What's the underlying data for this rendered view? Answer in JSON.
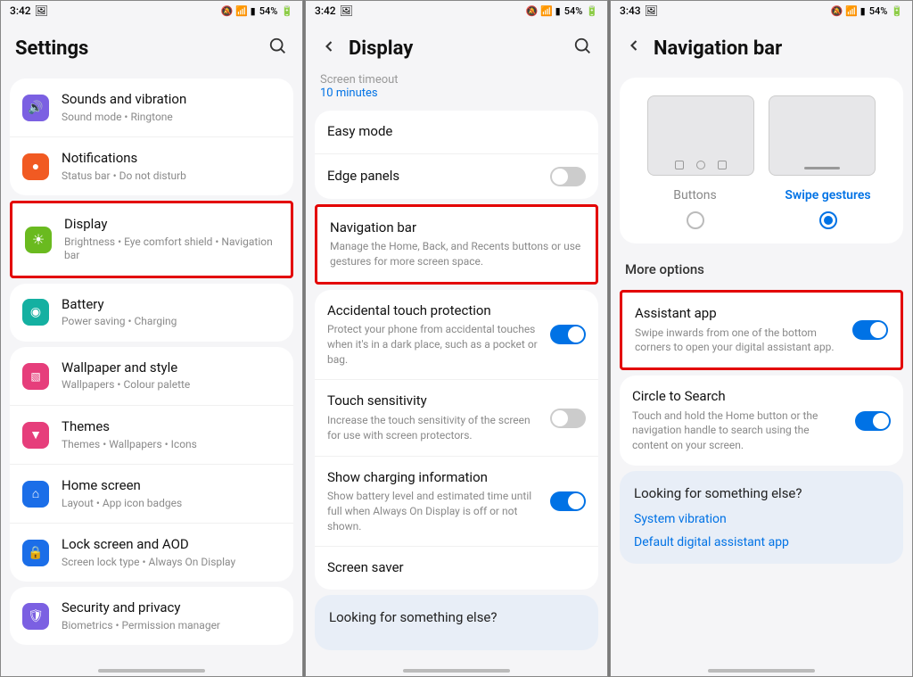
{
  "status": {
    "time_a": "3:42",
    "time_b": "3:42",
    "time_c": "3:43",
    "battery": "54%",
    "icons": "🔕 📶 📊"
  },
  "panel1": {
    "title": "Settings",
    "items": [
      {
        "title": "Sounds and vibration",
        "sub": "Sound mode  •  Ringtone",
        "color": "#7b60e2",
        "icon": "🔊"
      },
      {
        "title": "Notifications",
        "sub": "Status bar  •  Do not disturb",
        "color": "#f15a22",
        "icon": "🔔"
      },
      {
        "title": "Display",
        "sub": "Brightness  •  Eye comfort shield  •  Navigation bar",
        "color": "#6aba1f",
        "icon": "☀",
        "hl": true
      },
      {
        "title": "Battery",
        "sub": "Power saving  •  Charging",
        "color": "#14b0a1",
        "icon": "◎"
      },
      {
        "title": "Wallpaper and style",
        "sub": "Wallpapers  •  Colour palette",
        "color": "#e63e7b",
        "icon": "🖼"
      },
      {
        "title": "Themes",
        "sub": "Themes  •  Wallpapers  •  Icons",
        "color": "#e63e7b",
        "icon": "⬢"
      },
      {
        "title": "Home screen",
        "sub": "Layout  •  App icon badges",
        "color": "#1b6ee8",
        "icon": "⌂"
      },
      {
        "title": "Lock screen and AOD",
        "sub": "Screen lock type  •  Always On Display",
        "color": "#1b6ee8",
        "icon": "🔒"
      },
      {
        "title": "Security and privacy",
        "sub": "Biometrics  •  Permission manager",
        "color": "#7b60e2",
        "icon": "🛡"
      }
    ]
  },
  "panel2": {
    "title": "Display",
    "partial": "10 minutes",
    "items": [
      {
        "title": "Easy mode"
      },
      {
        "title": "Edge panels",
        "toggle": "off"
      },
      {
        "title": "Navigation bar",
        "desc": "Manage the Home, Back, and Recents buttons or use gestures for more screen space.",
        "hl": true
      },
      {
        "title": "Accidental touch protection",
        "desc": "Protect your phone from accidental touches when it's in a dark place, such as a pocket or bag.",
        "toggle": "on"
      },
      {
        "title": "Touch sensitivity",
        "desc": "Increase the touch sensitivity of the screen for use with screen protectors.",
        "toggle": "off"
      },
      {
        "title": "Show charging information",
        "desc": "Show battery level and estimated time until full when Always On Display is off or not shown.",
        "toggle": "on"
      },
      {
        "title": "Screen saver"
      }
    ],
    "footer": "Looking for something else?"
  },
  "panel3": {
    "title": "Navigation bar",
    "options": {
      "a": "Buttons",
      "b": "Swipe gestures"
    },
    "more": "More options",
    "items": [
      {
        "title": "Assistant app",
        "desc": "Swipe inwards from one of the bottom corners to open your digital assistant app.",
        "toggle": "on",
        "hl": true
      },
      {
        "title": "Circle to Search",
        "desc": "Touch and hold the Home button or the navigation handle to search using the content on your screen.",
        "toggle": "on"
      }
    ],
    "footer": {
      "title": "Looking for something else?",
      "link1": "System vibration",
      "link2": "Default digital assistant app"
    }
  }
}
